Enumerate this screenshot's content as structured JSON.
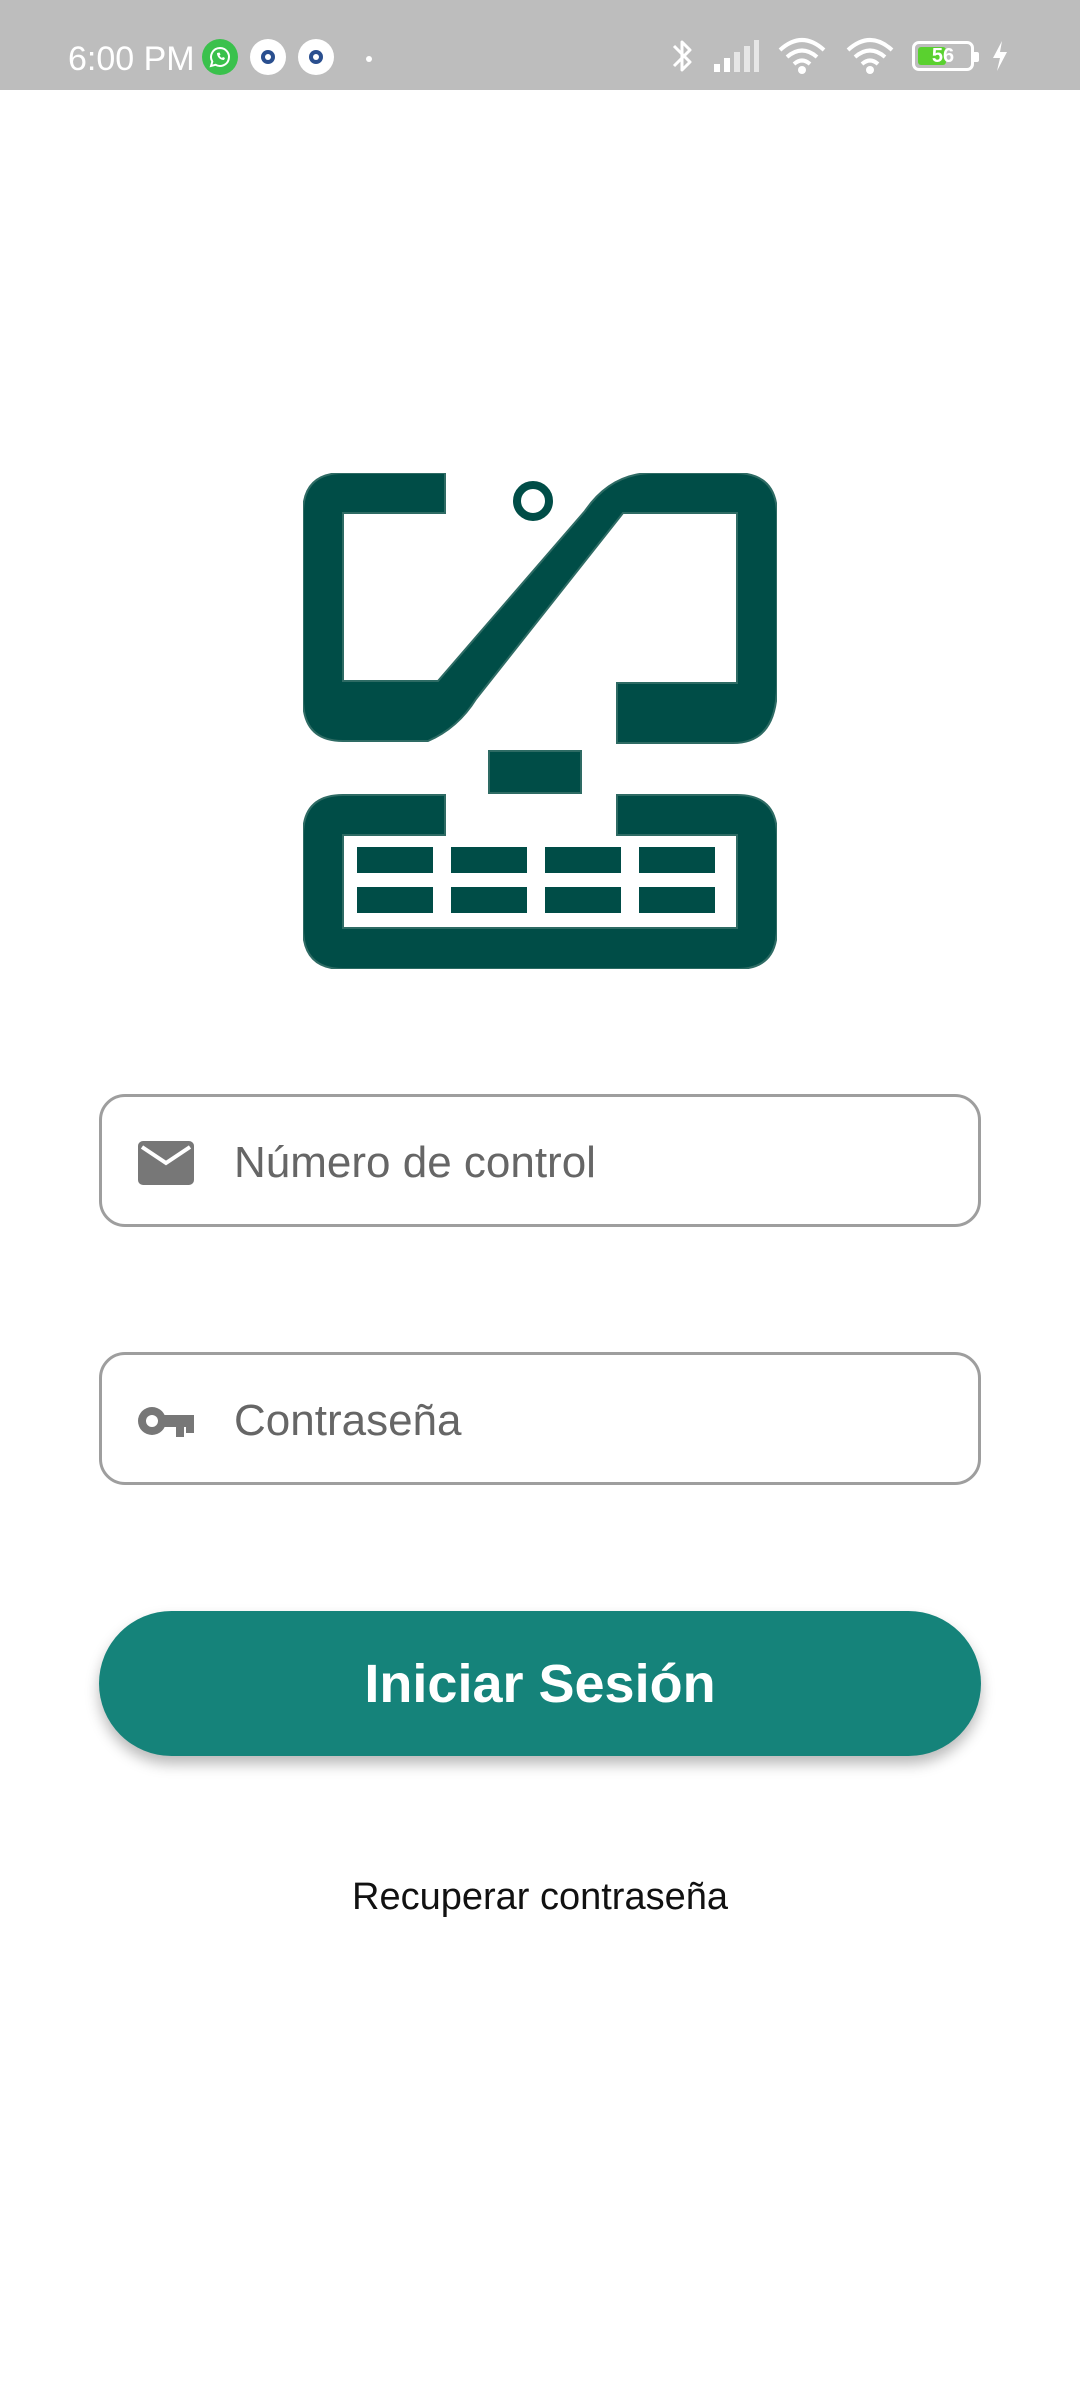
{
  "status_bar": {
    "time": "6:00 PM",
    "battery_percent": "56",
    "battery_level": 0.56,
    "icons": [
      "whatsapp-icon",
      "app-icon",
      "app-icon",
      "dot-icon",
      "bluetooth-icon",
      "signal-icon",
      "wifi-icon",
      "wifi-icon",
      "battery-icon",
      "charging-icon"
    ]
  },
  "login": {
    "email_placeholder": "Número de control",
    "password_placeholder": "Contraseña",
    "submit_label": "Iniciar Sesión",
    "recover_label": "Recuperar contraseña"
  },
  "colors": {
    "logo": "#004d47",
    "button": "#15837a",
    "status_bar": "#bdbdbd",
    "icon_gray": "#777777"
  }
}
